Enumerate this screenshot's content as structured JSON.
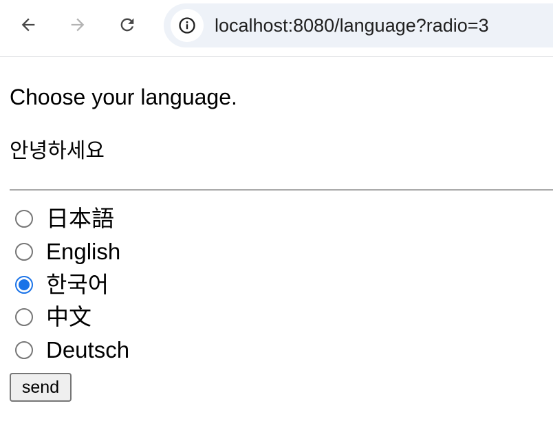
{
  "browser": {
    "url": "localhost:8080/language?radio=3",
    "icons": {
      "back": "back-arrow-icon",
      "forward": "forward-arrow-icon",
      "reload": "reload-icon",
      "site_info": "info-icon"
    },
    "forward_enabled": false
  },
  "page": {
    "prompt": "Choose your language.",
    "greeting": "안녕하세요",
    "options": [
      {
        "label": "日本語",
        "checked": false
      },
      {
        "label": "English",
        "checked": false
      },
      {
        "label": "한국어",
        "checked": true
      },
      {
        "label": "中文",
        "checked": false
      },
      {
        "label": "Deutsch",
        "checked": false
      }
    ],
    "send_label": "send"
  },
  "colors": {
    "accent": "#1a73e8",
    "omnibox_bg": "#eef2f8"
  }
}
